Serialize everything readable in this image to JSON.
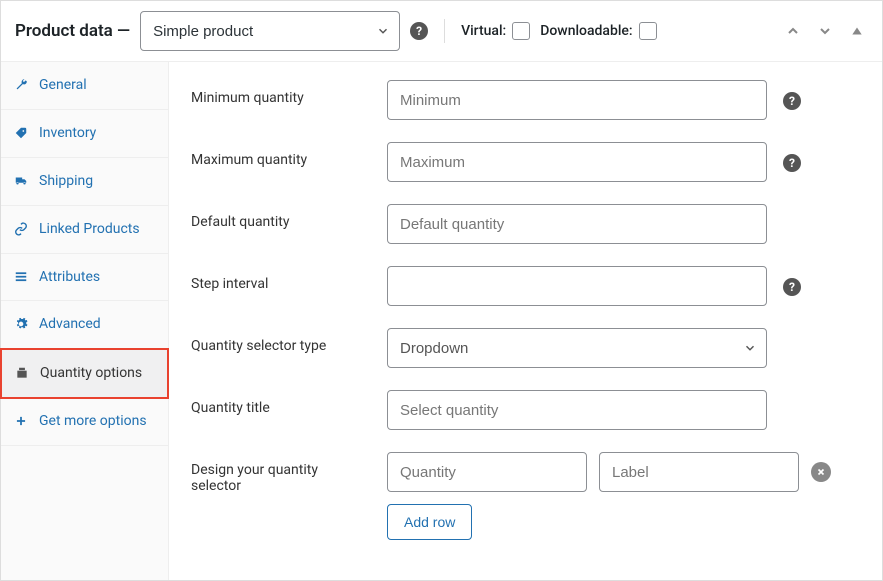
{
  "header": {
    "title": "Product data —",
    "product_type": "Simple product",
    "virtual_label": "Virtual:",
    "downloadable_label": "Downloadable:"
  },
  "sidebar": {
    "items": [
      {
        "label": "General",
        "icon": "wrench"
      },
      {
        "label": "Inventory",
        "icon": "tag"
      },
      {
        "label": "Shipping",
        "icon": "truck"
      },
      {
        "label": "Linked Products",
        "icon": "link"
      },
      {
        "label": "Attributes",
        "icon": "list"
      },
      {
        "label": "Advanced",
        "icon": "gear"
      },
      {
        "label": "Quantity options",
        "icon": "box",
        "active": true
      },
      {
        "label": "Get more options",
        "icon": "plus"
      }
    ]
  },
  "fields": {
    "min_qty": {
      "label": "Minimum quantity",
      "placeholder": "Minimum"
    },
    "max_qty": {
      "label": "Maximum quantity",
      "placeholder": "Maximum"
    },
    "default_qty": {
      "label": "Default quantity",
      "placeholder": "Default quantity"
    },
    "step_interval": {
      "label": "Step interval",
      "placeholder": ""
    },
    "selector_type": {
      "label": "Quantity selector type",
      "value": "Dropdown"
    },
    "qty_title": {
      "label": "Quantity title",
      "placeholder": "Select quantity"
    },
    "design": {
      "label": "Design your quantity selector",
      "col1_placeholder": "Quantity",
      "col2_placeholder": "Label",
      "add_row": "Add row"
    }
  }
}
